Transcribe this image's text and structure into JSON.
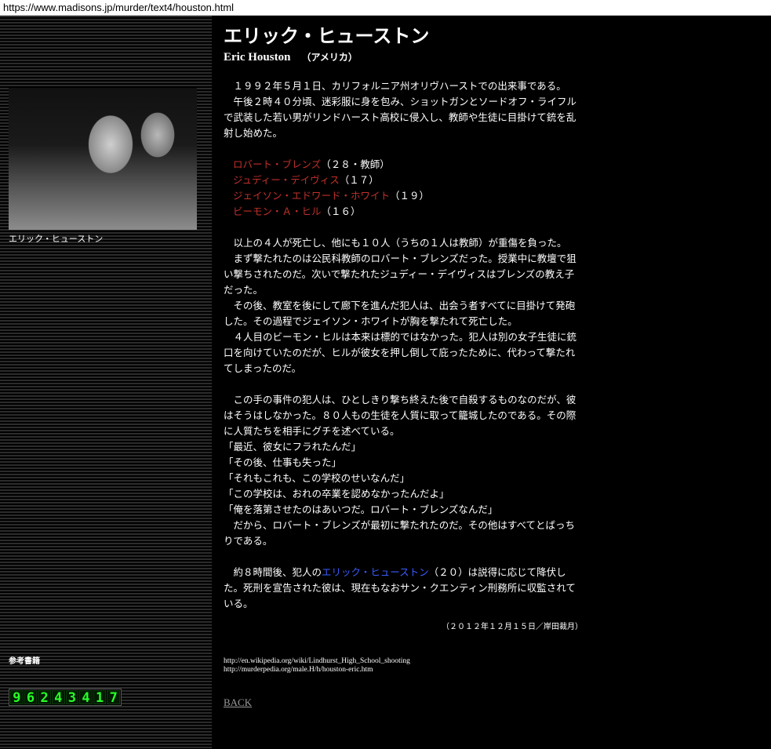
{
  "browser": {
    "url": "https://www.madisons.jp/murder/text4/houston.html"
  },
  "sidebar": {
    "photo_caption": "エリック・ヒューストン",
    "references_label": "参考書籍",
    "counter_digits": [
      "9",
      "6",
      "2",
      "4",
      "3",
      "4",
      "1",
      "7"
    ]
  },
  "article": {
    "title": "エリック・ヒューストン",
    "subtitle_name": "Eric Houston",
    "subtitle_country": "（アメリカ）",
    "intro": [
      "　１９９２年５月１日、カリフォルニア州オリヴハーストでの出来事である。",
      "　午後２時４０分頃、迷彩服に身を包み、ショットガンとソードオフ・ライフルで武装した若い男がリンドハースト高校に侵入し、教師や生徒に目掛けて銃を乱射し始めた。"
    ],
    "victims": [
      {
        "name": "ロバート・ブレンズ",
        "detail": "（２８・教師）"
      },
      {
        "name": "ジュディー・デイヴィス",
        "detail": "（１７）"
      },
      {
        "name": "ジェイソン・エドワード・ホワイト",
        "detail": "（１９）"
      },
      {
        "name": "ビーモン・Ａ・ヒル",
        "detail": "（１６）"
      }
    ],
    "body1": [
      "　以上の４人が死亡し、他にも１０人（うちの１人は教師）が重傷を負った。",
      "　まず撃たれたのは公民科教師のロバート・ブレンズだった。授業中に教壇で狙い撃ちされたのだ。次いで撃たれたジュディー・デイヴィスはブレンズの教え子だった。",
      "　その後、教室を後にして廊下を進んだ犯人は、出会う者すべてに目掛けて発砲した。その過程でジェイソン・ホワイトが胸を撃たれて死亡した。",
      "　４人目のビーモン・ヒルは本来は標的ではなかった。犯人は別の女子生徒に銃口を向けていたのだが、ヒルが彼女を押し倒して庇ったために、代わって撃たれてしまったのだ。"
    ],
    "body2": [
      "　この手の事件の犯人は、ひとしきり撃ち終えた後で自殺するものなのだが、彼はそうはしなかった。８０人もの生徒を人質に取って籠城したのである。その際に人質たちを相手にグチを述べている。",
      "「最近、彼女にフラれたんだ」",
      "「その後、仕事も失った」",
      "「それもこれも、この学校のせいなんだ」",
      "「この学校は、おれの卒業を認めなかったんだよ」",
      "「俺を落第させたのはあいつだ。ロバート・ブレンズなんだ」",
      "　だから、ロバート・ブレンズが最初に撃たれたのだ。その他はすべてとばっちりである。"
    ],
    "body3_pre": "　約８時間後、犯人の",
    "body3_link": "エリック・ヒューストン",
    "body3_post": "（２０）は説得に応じて降伏した。死刑を宣告された彼は、現在もなおサン・クエンティン刑務所に収監されている。",
    "date": "（２０１２年１２月１５日／岸田裁月）",
    "sources": [
      "http://en.wikipedia.org/wiki/Lindhurst_High_School_shooting",
      "http://murderpedia.org/male.H/h/houston-eric.htm"
    ],
    "back_label": "BACK"
  }
}
